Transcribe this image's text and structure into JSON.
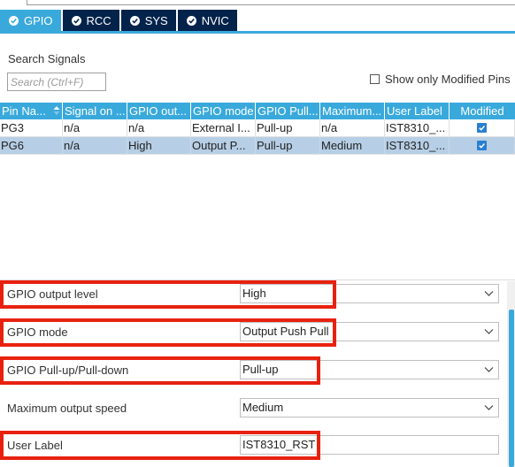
{
  "tabs": [
    {
      "label": "GPIO",
      "active": true
    },
    {
      "label": "RCC",
      "active": false
    },
    {
      "label": "SYS",
      "active": false
    },
    {
      "label": "NVIC",
      "active": false
    }
  ],
  "search": {
    "label": "Search Signals",
    "placeholder": "Search (Ctrl+F)",
    "show_modified_label": "Show only Modified Pins",
    "show_modified_checked": false
  },
  "table": {
    "columns": [
      "Pin Na...",
      "Signal on ...",
      "GPIO out...",
      "GPIO mode",
      "GPIO Pull...",
      "Maximum...",
      "User Label",
      "Modified"
    ],
    "rows": [
      {
        "pin": "PG3",
        "signal": "n/a",
        "output": "n/a",
        "mode": "External I...",
        "pull": "Pull-up",
        "speed": "n/a",
        "label": "IST8310_...",
        "modified": true,
        "selected": false
      },
      {
        "pin": "PG6",
        "signal": "n/a",
        "output": "High",
        "mode": "Output P...",
        "pull": "Pull-up",
        "speed": "Medium",
        "label": "IST8310_...",
        "modified": true,
        "selected": true
      }
    ]
  },
  "properties": {
    "output_level": {
      "label": "GPIO output level",
      "value": "High"
    },
    "mode": {
      "label": "GPIO mode",
      "value": "Output Push Pull"
    },
    "pull": {
      "label": "GPIO Pull-up/Pull-down",
      "value": "Pull-up"
    },
    "speed": {
      "label": "Maximum output speed",
      "value": "Medium"
    },
    "user_label": {
      "label": "User Label",
      "value": "IST8310_RST"
    }
  },
  "colors": {
    "tab_active": "#39a9dc",
    "tab_inactive": "#03234b",
    "header_bg": "#39a9dc",
    "selected_row": "#b7cfe6",
    "highlight_box": "#e8210f",
    "checkbox": "#2a7fd0"
  }
}
